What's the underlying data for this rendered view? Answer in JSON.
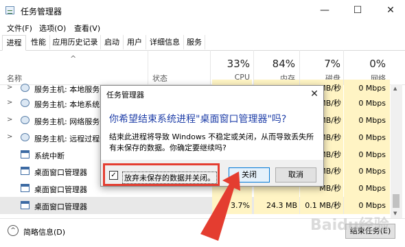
{
  "window": {
    "title": "任务管理器",
    "controls": {
      "minimize": "—",
      "maximize": "☐",
      "close": "✕"
    }
  },
  "menu": [
    "文件(F)",
    "选项(O)",
    "查看(V)"
  ],
  "tabs": [
    "进程",
    "性能",
    "应用历史记录",
    "启动",
    "用户",
    "详细信息",
    "服务"
  ],
  "active_tab": "进程",
  "columns": {
    "name": "名称",
    "status": "状态",
    "cpu": {
      "pct": "33%",
      "label": "CPU"
    },
    "memory": {
      "pct": "84%",
      "label": "内存"
    },
    "disk": {
      "pct": "7%",
      "label": "磁盘"
    },
    "network": {
      "pct": "0%",
      "label": "网络"
    },
    "sort_arrow": "^"
  },
  "rows": [
    {
      "name": "服务主机: 本地服务",
      "icon": "gear-icon",
      "expand": ">",
      "disk": "MB/秒",
      "network": "0 Mbps"
    },
    {
      "name": "服务主机: 本地系统(",
      "icon": "gear-icon",
      "expand": ">",
      "disk": "MB/秒",
      "network": "0 Mbps"
    },
    {
      "name": "服务主机: 网络服务",
      "icon": "gear-icon",
      "expand": ">",
      "disk": "MB/秒",
      "network": "0 Mbps"
    },
    {
      "name": "服务主机: 远程过程调",
      "icon": "gear-icon",
      "expand": ">",
      "disk": "MB/秒",
      "network": "0 Mbps"
    },
    {
      "name": "系统中断",
      "icon": "window-icon",
      "expand": "",
      "disk": "MB/秒",
      "network": "0 Mbps"
    },
    {
      "name": "桌面窗口管理器",
      "icon": "window-icon",
      "expand": "",
      "disk": "MB/秒",
      "network": "0 Mbps"
    },
    {
      "name": "桌面窗口管理器",
      "icon": "window-icon",
      "expand": "",
      "disk": "MB/秒",
      "network": "0 Mbps"
    },
    {
      "name": "桌面窗口管理器",
      "icon": "window-icon",
      "expand": "",
      "cpu": "3.7%",
      "memory": "24.3 MB",
      "disk": "0.1 MB/秒",
      "network": "0 Mbps"
    }
  ],
  "footer": {
    "fewer_details": "简略信息(D)",
    "fewer_icon": "^",
    "end_task": "结束任务(E)"
  },
  "dialog": {
    "title": "任务管理器",
    "close": "✕",
    "heading": "你希望结束系统进程\"桌面窗口管理器\"吗?",
    "body": "结束此进程将导致 Windows 不稳定或关闭，从而导致丢失所有未保存的数据。你确定要继续吗?",
    "checkbox_label": "放弃未保存的数据并关闭。",
    "checkbox_mark": "✓",
    "checked": true,
    "btn_close": "关闭",
    "btn_cancel": "取消"
  },
  "annotation_color": "#e43d30",
  "watermark": "Baidu经验"
}
